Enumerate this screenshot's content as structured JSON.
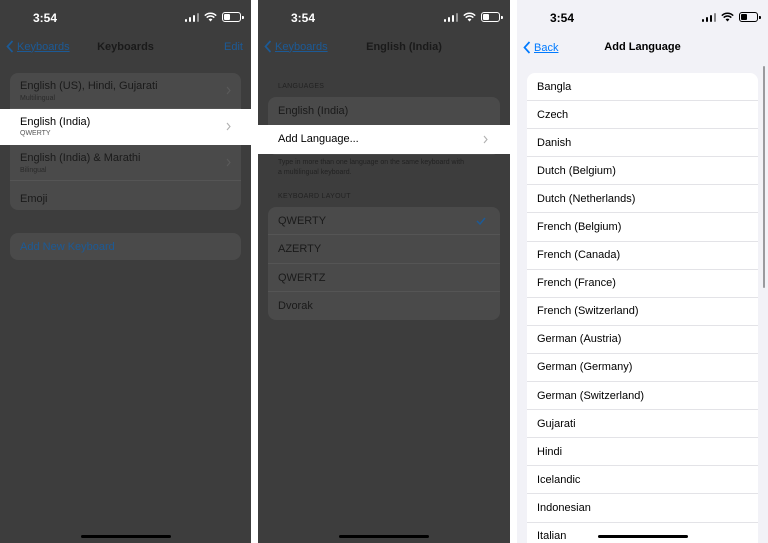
{
  "status": {
    "time": "3:54"
  },
  "screen1": {
    "nav": {
      "back": "Keyboards",
      "title": "Keyboards",
      "edit": "Edit"
    },
    "keyboards": [
      {
        "label": "English (US), Hindi, Gujarati",
        "sub": "Multilingual"
      },
      {
        "label": "English (India)",
        "sub": "QWERTY"
      },
      {
        "label": "English (India) & Marathi",
        "sub": "Bilingual"
      },
      {
        "label": "Emoji",
        "sub": ""
      }
    ],
    "add_new": "Add New Keyboard"
  },
  "screen2": {
    "nav": {
      "back": "Keyboards",
      "title": "English (India)"
    },
    "languages_header": "LANGUAGES",
    "languages": [
      "English (India)",
      "Add Language..."
    ],
    "languages_note": "Type in more than one language on the same keyboard with a multilingual keyboard.",
    "layout_header": "KEYBOARD LAYOUT",
    "layouts": [
      "QWERTY",
      "AZERTY",
      "QWERTZ",
      "Dvorak"
    ],
    "selected_layout": "QWERTY"
  },
  "screen3": {
    "nav": {
      "back": "Back",
      "title": "Add Language"
    },
    "languages": [
      "Bangla",
      "Czech",
      "Danish",
      "Dutch (Belgium)",
      "Dutch (Netherlands)",
      "French (Belgium)",
      "French (Canada)",
      "French (France)",
      "French (Switzerland)",
      "German (Austria)",
      "German (Germany)",
      "German (Switzerland)",
      "Gujarati",
      "Hindi",
      "Icelandic",
      "Indonesian",
      "Italian"
    ]
  },
  "colors": {
    "accent": "#007aff",
    "dim_overlay": "#3d3d3d",
    "highlight": "#ffffff"
  }
}
